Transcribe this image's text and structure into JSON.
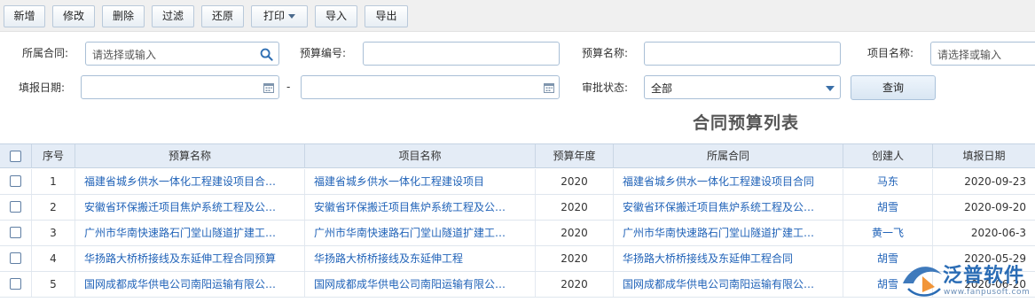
{
  "toolbar": {
    "add": "新增",
    "edit": "修改",
    "delete": "删除",
    "filter": "过滤",
    "restore": "还原",
    "print": "打印",
    "import": "导入",
    "export": "导出"
  },
  "filters": {
    "contract_label": "所属合同:",
    "contract_placeholder": "请选择或输入",
    "budget_no_label": "预算编号:",
    "budget_no_value": "",
    "budget_name_label": "预算名称:",
    "budget_name_value": "",
    "project_label": "项目名称:",
    "project_placeholder": "请选择或输入",
    "date_label": "填报日期:",
    "date_from": "",
    "date_to": "",
    "date_separator": "-",
    "approval_label": "审批状态:",
    "approval_value": "全部",
    "query_button": "查询"
  },
  "title": "合同预算列表",
  "table": {
    "headers": {
      "seq": "序号",
      "budget_name": "预算名称",
      "project_name": "项目名称",
      "budget_year": "预算年度",
      "contract": "所属合同",
      "creator": "创建人",
      "date": "填报日期"
    },
    "rows": [
      {
        "seq": "1",
        "budget_name": "福建省城乡供水一体化工程建设项目合…",
        "project_name": "福建省城乡供水一体化工程建设项目",
        "budget_year": "2020",
        "contract": "福建省城乡供水一体化工程建设项目合同",
        "creator": "马东",
        "date": "2020-09-23"
      },
      {
        "seq": "2",
        "budget_name": "安徽省环保搬迁项目焦炉系统工程及公…",
        "project_name": "安徽省环保搬迁项目焦炉系统工程及公…",
        "budget_year": "2020",
        "contract": "安徽省环保搬迁项目焦炉系统工程及公…",
        "creator": "胡雪",
        "date": "2020-09-20"
      },
      {
        "seq": "3",
        "budget_name": "广州市华南快速路石门堂山隧道扩建工…",
        "project_name": "广州市华南快速路石门堂山隧道扩建工…",
        "budget_year": "2020",
        "contract": "广州市华南快速路石门堂山隧道扩建工…",
        "creator": "黄一飞",
        "date": "2020-06-3"
      },
      {
        "seq": "4",
        "budget_name": "华扬路大桥桥接线及东延伸工程合同预算",
        "project_name": "华扬路大桥桥接线及东延伸工程",
        "budget_year": "2020",
        "contract": "华扬路大桥桥接线及东延伸工程合同",
        "creator": "胡雪",
        "date": "2020-05-29"
      },
      {
        "seq": "5",
        "budget_name": "国网成都成华供电公司南阳运输有限公…",
        "project_name": "国网成都成华供电公司南阳运输有限公…",
        "budget_year": "2020",
        "contract": "国网成都成华供电公司南阳运输有限公…",
        "creator": "胡雪",
        "date": "2020-06-20"
      }
    ]
  },
  "logo": {
    "name": "泛普软件",
    "url_text": "www.fanpusoft.com"
  },
  "colors": {
    "link": "#2163b8",
    "header_bg": "#e4ecf6",
    "field_border": "#a9bfd6",
    "logo_blue": "#2a6cb5"
  },
  "icons": [
    "search-icon",
    "calendar-icon",
    "chevron-down-icon",
    "checkbox-icon",
    "logo-icon"
  ]
}
